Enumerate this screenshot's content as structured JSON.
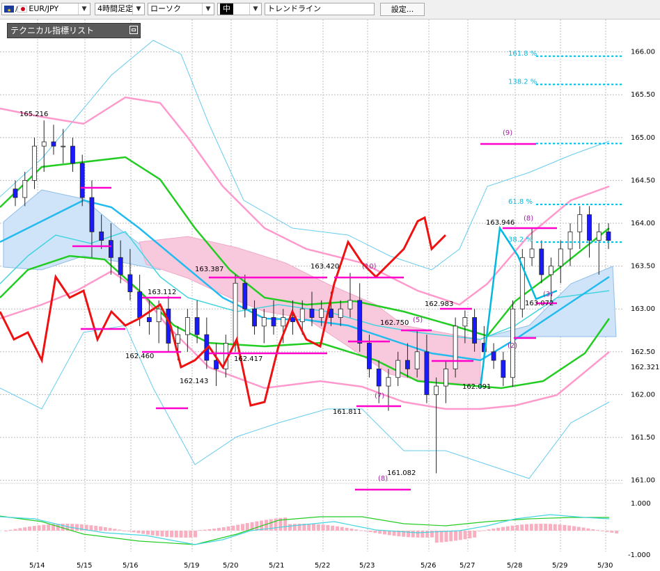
{
  "toolbar": {
    "symbol": "EUR/JPY",
    "timeframe": "4時間足定",
    "chart_type": "ローソク",
    "line_width": "中",
    "tool": "トレンドライン",
    "settings_button": "設定..."
  },
  "indicator_panel": {
    "title": "テクニカル指標リスト"
  },
  "colors": {
    "candle_up": "#ffffff",
    "candle_down": "#1a1aff",
    "ma_green": "#22cc22",
    "ma_blue": "#22bbee",
    "price_red": "#ee1111",
    "bollinger_pink": "#ff99cc",
    "bollinger_blue": "#66ccee",
    "cloud_blue": "#cfe4f8",
    "cloud_pink": "#f8c8dc",
    "magenta": "#ff00cc",
    "fib_cyan": "#00b8e0"
  },
  "chart_data": {
    "type": "candlestick",
    "x_labels": [
      "5/14",
      "5/15",
      "5/16",
      "5/19",
      "5/20",
      "5/21",
      "5/22",
      "5/23",
      "5/26",
      "5/27",
      "5/28",
      "5/29",
      "5/30"
    ],
    "y_ticks": [
      "166.00",
      "165.50",
      "165.00",
      "164.50",
      "164.00",
      "163.50",
      "163.00",
      "162.50",
      "162.321",
      "162.00",
      "161.50",
      "161.00"
    ],
    "ylim": [
      160.9,
      166.25
    ],
    "oscillator_ticks": [
      "1.000",
      "-1.000"
    ],
    "price_labels": [
      "165.216",
      "163.387",
      "163.420",
      "163.112",
      "162.460",
      "162.143",
      "162.417",
      "162.750",
      "162.983",
      "161.811",
      "161.082",
      "163.946",
      "163.072",
      "162.091"
    ],
    "fib_labels": [
      "161.8 %",
      "138.2 %",
      "61.8 %",
      "38.2 %"
    ],
    "wave_labels": [
      "(9)",
      "(8)",
      "(10)",
      "(5)",
      "(7)",
      "(8)",
      "(2)",
      "(3)"
    ],
    "candles": [
      [
        164.4,
        164.5,
        164.2,
        164.3
      ],
      [
        164.3,
        164.6,
        164.2,
        164.5
      ],
      [
        164.5,
        165.0,
        164.4,
        164.9
      ],
      [
        164.9,
        165.2,
        164.6,
        164.95
      ],
      [
        164.95,
        165.15,
        164.8,
        164.9
      ],
      [
        164.9,
        165.1,
        164.7,
        164.9
      ],
      [
        164.9,
        165.0,
        164.6,
        164.7
      ],
      [
        164.7,
        164.8,
        164.2,
        164.3
      ],
      [
        164.3,
        164.5,
        163.6,
        163.9
      ],
      [
        163.9,
        164.1,
        163.7,
        163.8
      ],
      [
        163.8,
        164.0,
        163.4,
        163.6
      ],
      [
        163.6,
        163.8,
        163.3,
        163.4
      ],
      [
        163.4,
        163.7,
        163.1,
        163.2
      ],
      [
        163.2,
        163.4,
        162.8,
        162.9
      ],
      [
        162.9,
        163.1,
        162.7,
        162.85
      ],
      [
        162.85,
        163.1,
        162.6,
        163.0
      ],
      [
        163.0,
        163.15,
        162.5,
        162.6
      ],
      [
        162.6,
        162.8,
        162.4,
        162.7
      ],
      [
        162.7,
        163.0,
        162.5,
        162.9
      ],
      [
        162.9,
        163.1,
        162.6,
        162.7
      ],
      [
        162.7,
        162.9,
        162.3,
        162.4
      ],
      [
        162.4,
        162.6,
        162.1,
        162.3
      ],
      [
        162.3,
        162.7,
        162.2,
        162.6
      ],
      [
        162.6,
        163.4,
        162.5,
        163.3
      ],
      [
        163.3,
        163.4,
        162.9,
        163.0
      ],
      [
        163.0,
        163.1,
        162.7,
        162.8
      ],
      [
        162.8,
        163.0,
        162.6,
        162.9
      ],
      [
        162.9,
        163.1,
        162.7,
        162.8
      ],
      [
        162.8,
        163.0,
        162.6,
        162.9
      ],
      [
        162.9,
        163.1,
        162.7,
        162.85
      ],
      [
        162.85,
        163.1,
        162.7,
        163.0
      ],
      [
        163.0,
        163.2,
        162.8,
        162.9
      ],
      [
        162.9,
        163.1,
        162.8,
        163.0
      ],
      [
        163.0,
        163.2,
        162.8,
        162.9
      ],
      [
        162.9,
        163.1,
        162.8,
        163.0
      ],
      [
        163.0,
        163.42,
        162.9,
        163.1
      ],
      [
        163.1,
        163.3,
        162.5,
        162.6
      ],
      [
        162.6,
        162.7,
        162.2,
        162.3
      ],
      [
        162.3,
        162.4,
        161.9,
        162.1
      ],
      [
        162.1,
        162.3,
        161.811,
        162.2
      ],
      [
        162.2,
        162.5,
        162.1,
        162.4
      ],
      [
        162.4,
        162.6,
        162.2,
        162.3
      ],
      [
        162.3,
        162.75,
        162.2,
        162.5
      ],
      [
        162.5,
        162.7,
        161.9,
        162.0
      ],
      [
        162.0,
        162.2,
        161.082,
        162.1
      ],
      [
        162.1,
        162.4,
        161.9,
        162.3
      ],
      [
        162.3,
        162.9,
        162.2,
        162.8
      ],
      [
        162.8,
        162.983,
        162.6,
        162.9
      ],
      [
        162.9,
        163.0,
        162.5,
        162.6
      ],
      [
        162.6,
        162.8,
        162.4,
        162.5
      ],
      [
        162.5,
        162.6,
        162.3,
        162.4
      ],
      [
        162.4,
        162.5,
        162.1,
        162.2
      ],
      [
        162.2,
        163.1,
        162.091,
        163.0
      ],
      [
        163.0,
        163.7,
        162.9,
        163.6
      ],
      [
        163.6,
        163.946,
        163.5,
        163.7
      ],
      [
        163.7,
        163.8,
        163.3,
        163.4
      ],
      [
        163.4,
        163.6,
        163.072,
        163.5
      ],
      [
        163.5,
        163.8,
        163.3,
        163.7
      ],
      [
        163.7,
        164.0,
        163.5,
        163.9
      ],
      [
        163.9,
        164.2,
        163.7,
        164.1
      ],
      [
        164.1,
        164.2,
        163.6,
        163.8
      ],
      [
        163.8,
        164.0,
        163.4,
        163.9
      ],
      [
        163.9,
        164.0,
        163.7,
        163.8
      ]
    ]
  }
}
